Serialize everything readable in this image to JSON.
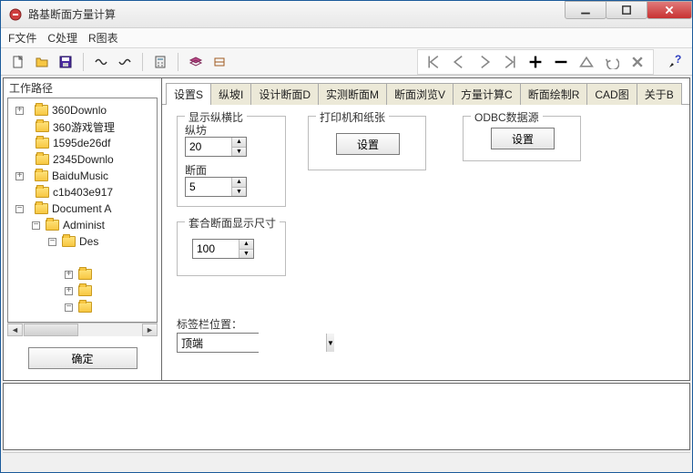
{
  "window": {
    "title": "路基断面方量计算"
  },
  "menu": {
    "file": "F文件",
    "process": "C处理",
    "chart": "R图表"
  },
  "left": {
    "title": "工作路径",
    "ok": "确定",
    "tree": [
      "360Downlo",
      "360游戏管理",
      "1595de26df",
      "2345Downlo",
      "BaiduMusic",
      "c1b403e917",
      "Document A",
      "Administ",
      "Des"
    ]
  },
  "tabs": {
    "t0": "设置S",
    "t1": "纵坡I",
    "t2": "设计断面D",
    "t3": "实测断面M",
    "t4": "断面浏览V",
    "t5": "方量计算C",
    "t6": "断面绘制R",
    "t7": "CAD图",
    "t8": "关于B"
  },
  "form": {
    "group_ratio": "显示纵横比",
    "label_zong": "纵坊",
    "val_zong": "20",
    "label_duan": "断面",
    "val_duan": "5",
    "group_printer": "打印机和纸张",
    "btn_printer": "设置",
    "group_odbc": "ODBC数据源",
    "btn_odbc": "设置",
    "group_size": "套合断面显示尺寸",
    "val_size": "100",
    "label_tabpos": "标签栏位置：",
    "val_tabpos": "顶端"
  }
}
